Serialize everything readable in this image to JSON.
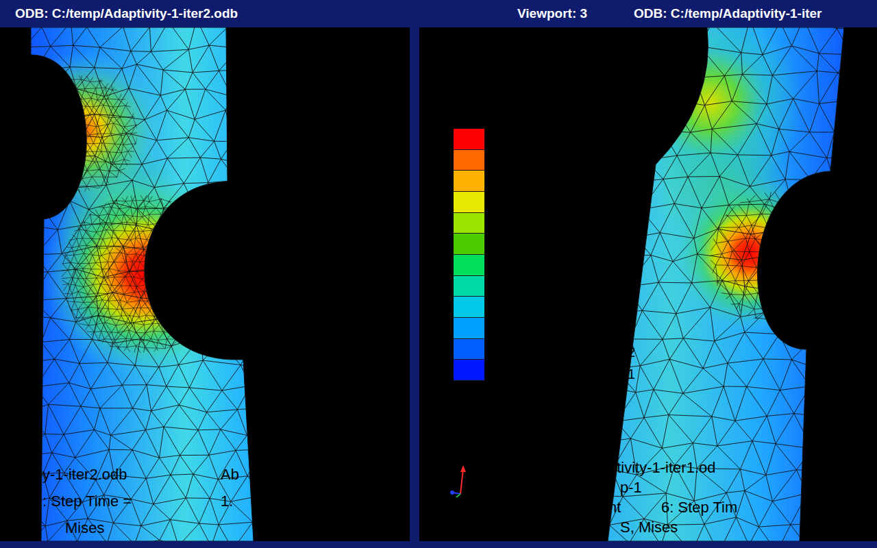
{
  "window": {
    "title": "ODB: C:/temp/Adaptivity-1-iter2.odb",
    "viewport": "Viewport: 3",
    "second_title": "ODB: C:/temp/Adaptivity-1-iter"
  },
  "viewports": [
    {
      "name": "iter2",
      "info_rows": [
        [
          "y-1-iter2.odb",
          "Ab"
        ],
        [
          ": Step Time =",
          "1."
        ],
        [
          "Mises"
        ]
      ],
      "triad_labels": []
    },
    {
      "name": "iter1",
      "info_rows": [
        [
          "ptivity-1-iter1.od"
        ],
        [
          "p-1"
        ],
        [
          "nt",
          "6: Step Tim"
        ],
        [
          "S, Mises"
        ]
      ],
      "triad_labels": [
        "2",
        "1"
      ]
    }
  ],
  "legend": [
    {
      "color": "#ff0000"
    },
    {
      "color": "#ff6a00"
    },
    {
      "color": "#ffb300"
    },
    {
      "color": "#e8e800"
    },
    {
      "color": "#9be600"
    },
    {
      "color": "#4ccd00"
    },
    {
      "color": "#00e05a"
    },
    {
      "color": "#00dca8"
    },
    {
      "color": "#00c8e6"
    },
    {
      "color": "#00a0ff"
    },
    {
      "color": "#0060ff"
    },
    {
      "color": "#0018ff"
    }
  ]
}
